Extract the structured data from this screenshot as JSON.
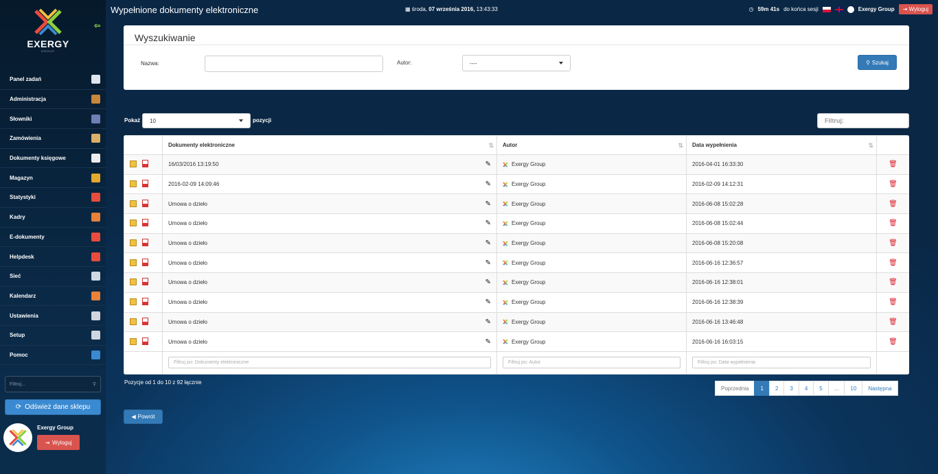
{
  "app": {
    "brand": "EXERGY",
    "brand_sub": "GROUP",
    "page_title": "Wypełnione dokumenty elektroniczne"
  },
  "header": {
    "date_day": "środa,",
    "date_main": "07 września 2016,",
    "date_time": "13:43:33",
    "session": "59m 41s",
    "session_suffix": "do końca sesji",
    "user": "Exergy Group",
    "logout": "Wyloguj"
  },
  "sidebar": {
    "items": [
      {
        "label": "Panel zadań",
        "icon": "home-icon",
        "color": "#dfe6ee"
      },
      {
        "label": "Administracja",
        "icon": "books-icon",
        "color": "#c8873a"
      },
      {
        "label": "Słowniki",
        "icon": "book-icon",
        "color": "#6f7fb5"
      },
      {
        "label": "Zamówienia",
        "icon": "box-icon",
        "color": "#d9b066"
      },
      {
        "label": "Dokumenty księgowe",
        "icon": "document-icon",
        "color": "#eeeeee"
      },
      {
        "label": "Magazyn",
        "icon": "forklift-icon",
        "color": "#e3a92c"
      },
      {
        "label": "Statystyki",
        "icon": "pie-chart-icon",
        "color": "#e84c3d"
      },
      {
        "label": "Kadry",
        "icon": "pin-icon",
        "color": "#e8813a"
      },
      {
        "label": "E-dokumenty",
        "icon": "pdf-icon",
        "color": "#e84c3d"
      },
      {
        "label": "Helpdesk",
        "icon": "lifebuoy-icon",
        "color": "#e84c3d"
      },
      {
        "label": "Sieć",
        "icon": "wrench-icon",
        "color": "#cfd8e2"
      },
      {
        "label": "Kalendarz",
        "icon": "calendar-icon",
        "color": "#e8813a"
      },
      {
        "label": "Ustawienia",
        "icon": "gear-icon",
        "color": "#d0d6dc"
      },
      {
        "label": "Setup",
        "icon": "setup-icon",
        "color": "#cfd8e2"
      },
      {
        "label": "Pomoc",
        "icon": "help-icon",
        "color": "#3a8ad1"
      }
    ],
    "filter_placeholder": "Filtruj...",
    "refresh_label": "Odśwież dane sklepu",
    "user_name": "Exergy Group",
    "logout_label": "Wyloguj"
  },
  "search": {
    "title": "Wyszukiwanie",
    "name_label": "Nazwa:",
    "name_value": "",
    "author_label": "Autor:",
    "author_value": "----",
    "button": "Szukaj"
  },
  "list_controls": {
    "show_label": "Pokaż",
    "show_value": "10",
    "show_suffix": "pozycji",
    "filter_placeholder": "Filtruj:"
  },
  "table": {
    "columns": [
      "Dokumenty elektroniczne",
      "Autor",
      "Data wypełnienia"
    ],
    "rows": [
      {
        "doc": "16/03/2016 13:19:50",
        "author": "Exergy Group",
        "date": "2016-04-01 16:33:30"
      },
      {
        "doc": "2016-02-09 14:09:46",
        "author": "Exergy Group",
        "date": "2016-02-09 14:12:31"
      },
      {
        "doc": "Umowa o dzieło",
        "author": "Exergy Group",
        "date": "2016-06-08 15:02:28"
      },
      {
        "doc": "Umowa o dzieło",
        "author": "Exergy Group",
        "date": "2016-06-08 15:02:44"
      },
      {
        "doc": "Umowa o dzieło",
        "author": "Exergy Group",
        "date": "2016-06-08 15:20:08"
      },
      {
        "doc": "Umowa o dzieło",
        "author": "Exergy Group",
        "date": "2016-06-16 12:36:57"
      },
      {
        "doc": "Umowa o dzieło",
        "author": "Exergy Group",
        "date": "2016-06-16 12:38:01"
      },
      {
        "doc": "Umowa o dzieło",
        "author": "Exergy Group",
        "date": "2016-06-16 12:38:39"
      },
      {
        "doc": "Umowa o dzieło",
        "author": "Exergy Group",
        "date": "2016-06-16 13:46:48"
      },
      {
        "doc": "Umowa o dzieło",
        "author": "Exergy Group",
        "date": "2016-06-16 16:03:15"
      }
    ],
    "filters": [
      "Filtruj po: Dokumenty elektroniczne",
      "Filtruj po: Autor",
      "Filtruj po: Data wypełnienia"
    ]
  },
  "footer": {
    "info": "Pozycje od 1 do 10 z 92 łącznie",
    "pagination": [
      "Poprzednia",
      "1",
      "2",
      "3",
      "4",
      "5",
      "...",
      "10",
      "Następna"
    ],
    "active_page": "1",
    "back_label": "Powrót"
  }
}
